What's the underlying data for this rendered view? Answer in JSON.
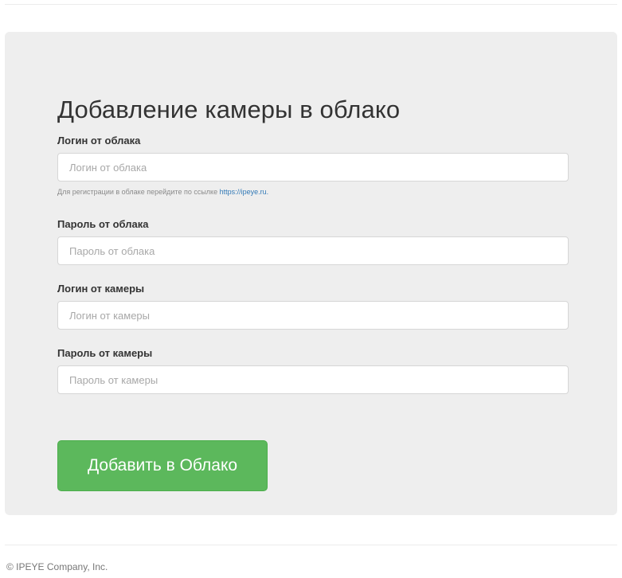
{
  "form": {
    "title": "Добавление камеры в облако",
    "cloud_login": {
      "label": "Логин от облака",
      "placeholder": "Логин от облака",
      "value": ""
    },
    "help": {
      "text": "Для регистрации в облаке перейдите по ссылке ",
      "link_text": "https://ipeye.ru."
    },
    "cloud_password": {
      "label": "Пароль от облака",
      "placeholder": "Пароль от облака",
      "value": ""
    },
    "camera_login": {
      "label": "Логин от камеры",
      "placeholder": "Логин от камеры",
      "value": ""
    },
    "camera_password": {
      "label": "Пароль от камеры",
      "placeholder": "Пароль от камеры",
      "value": ""
    },
    "submit_label": "Добавить в Облако"
  },
  "footer": {
    "copyright": "© IPEYE Company, Inc."
  },
  "colors": {
    "panel_background": "#eeeeee",
    "button_green": "#5cb85c",
    "link_blue": "#337ab7"
  }
}
